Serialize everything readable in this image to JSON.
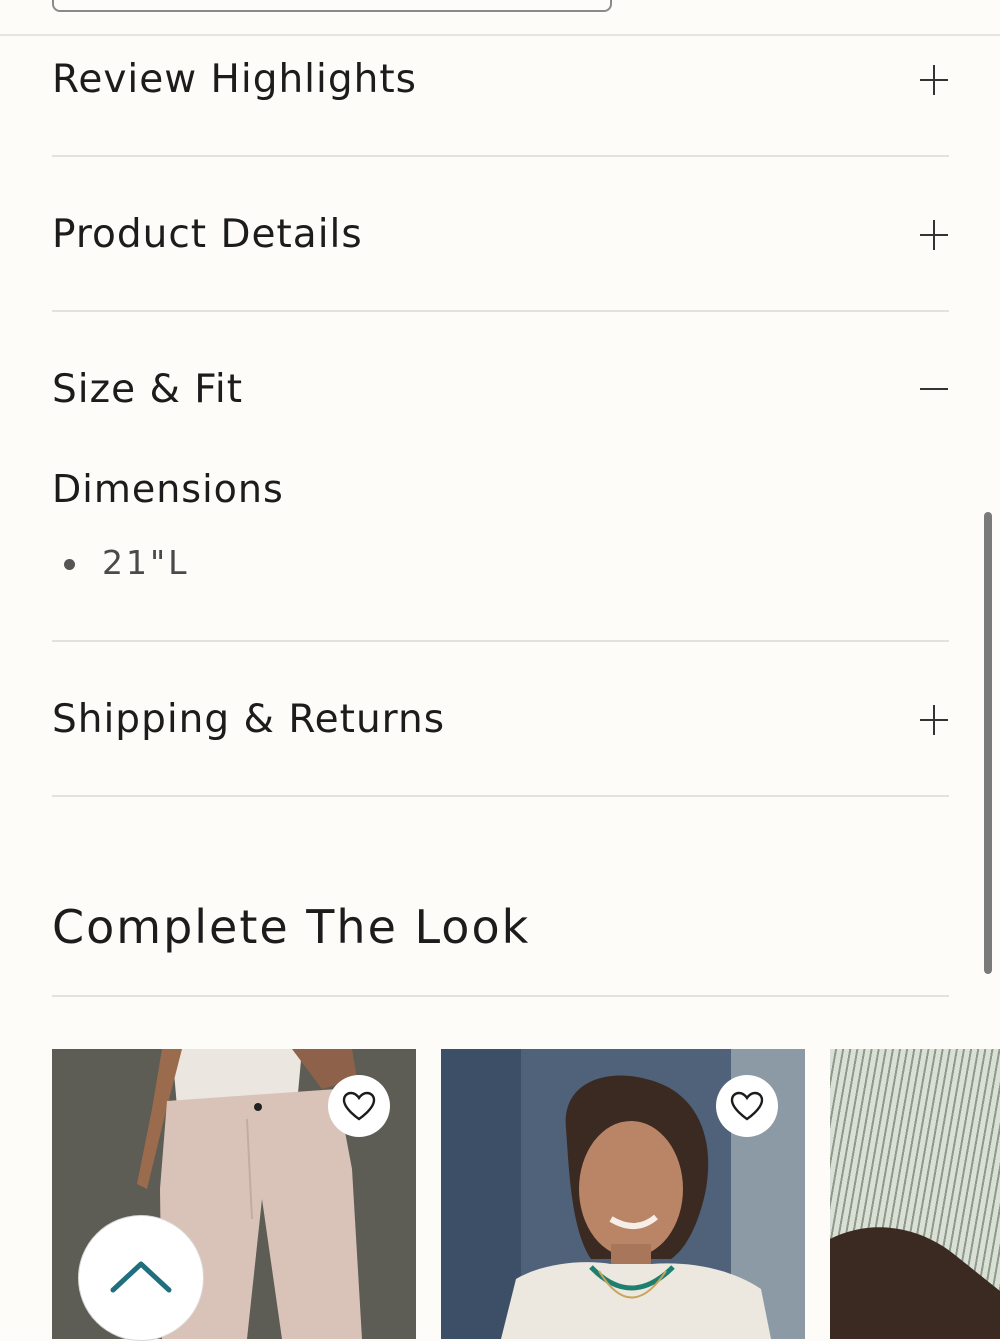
{
  "accordion": {
    "items": [
      {
        "title": "Review Highlights",
        "expanded": false
      },
      {
        "title": "Product Details",
        "expanded": false
      },
      {
        "title": "Size & Fit",
        "expanded": true
      },
      {
        "title": "Shipping & Returns",
        "expanded": false
      }
    ],
    "size_fit": {
      "subheading": "Dimensions",
      "bullets": [
        "21\"L"
      ]
    }
  },
  "complete_the_look": {
    "title": "Complete The Look",
    "products": [
      {
        "image": "pants-outfit-image",
        "favorite_icon": "heart-icon"
      },
      {
        "image": "model-portrait-image",
        "favorite_icon": "heart-icon"
      },
      {
        "image": "striped-fabric-image"
      }
    ]
  },
  "colors": {
    "background": "#fdfcf8",
    "accent": "#1f6f7f",
    "text": "#1c1c1c"
  },
  "icons": {
    "expand": "plus-icon",
    "collapse": "minus-icon",
    "back_to_top": "chevron-up-icon"
  }
}
